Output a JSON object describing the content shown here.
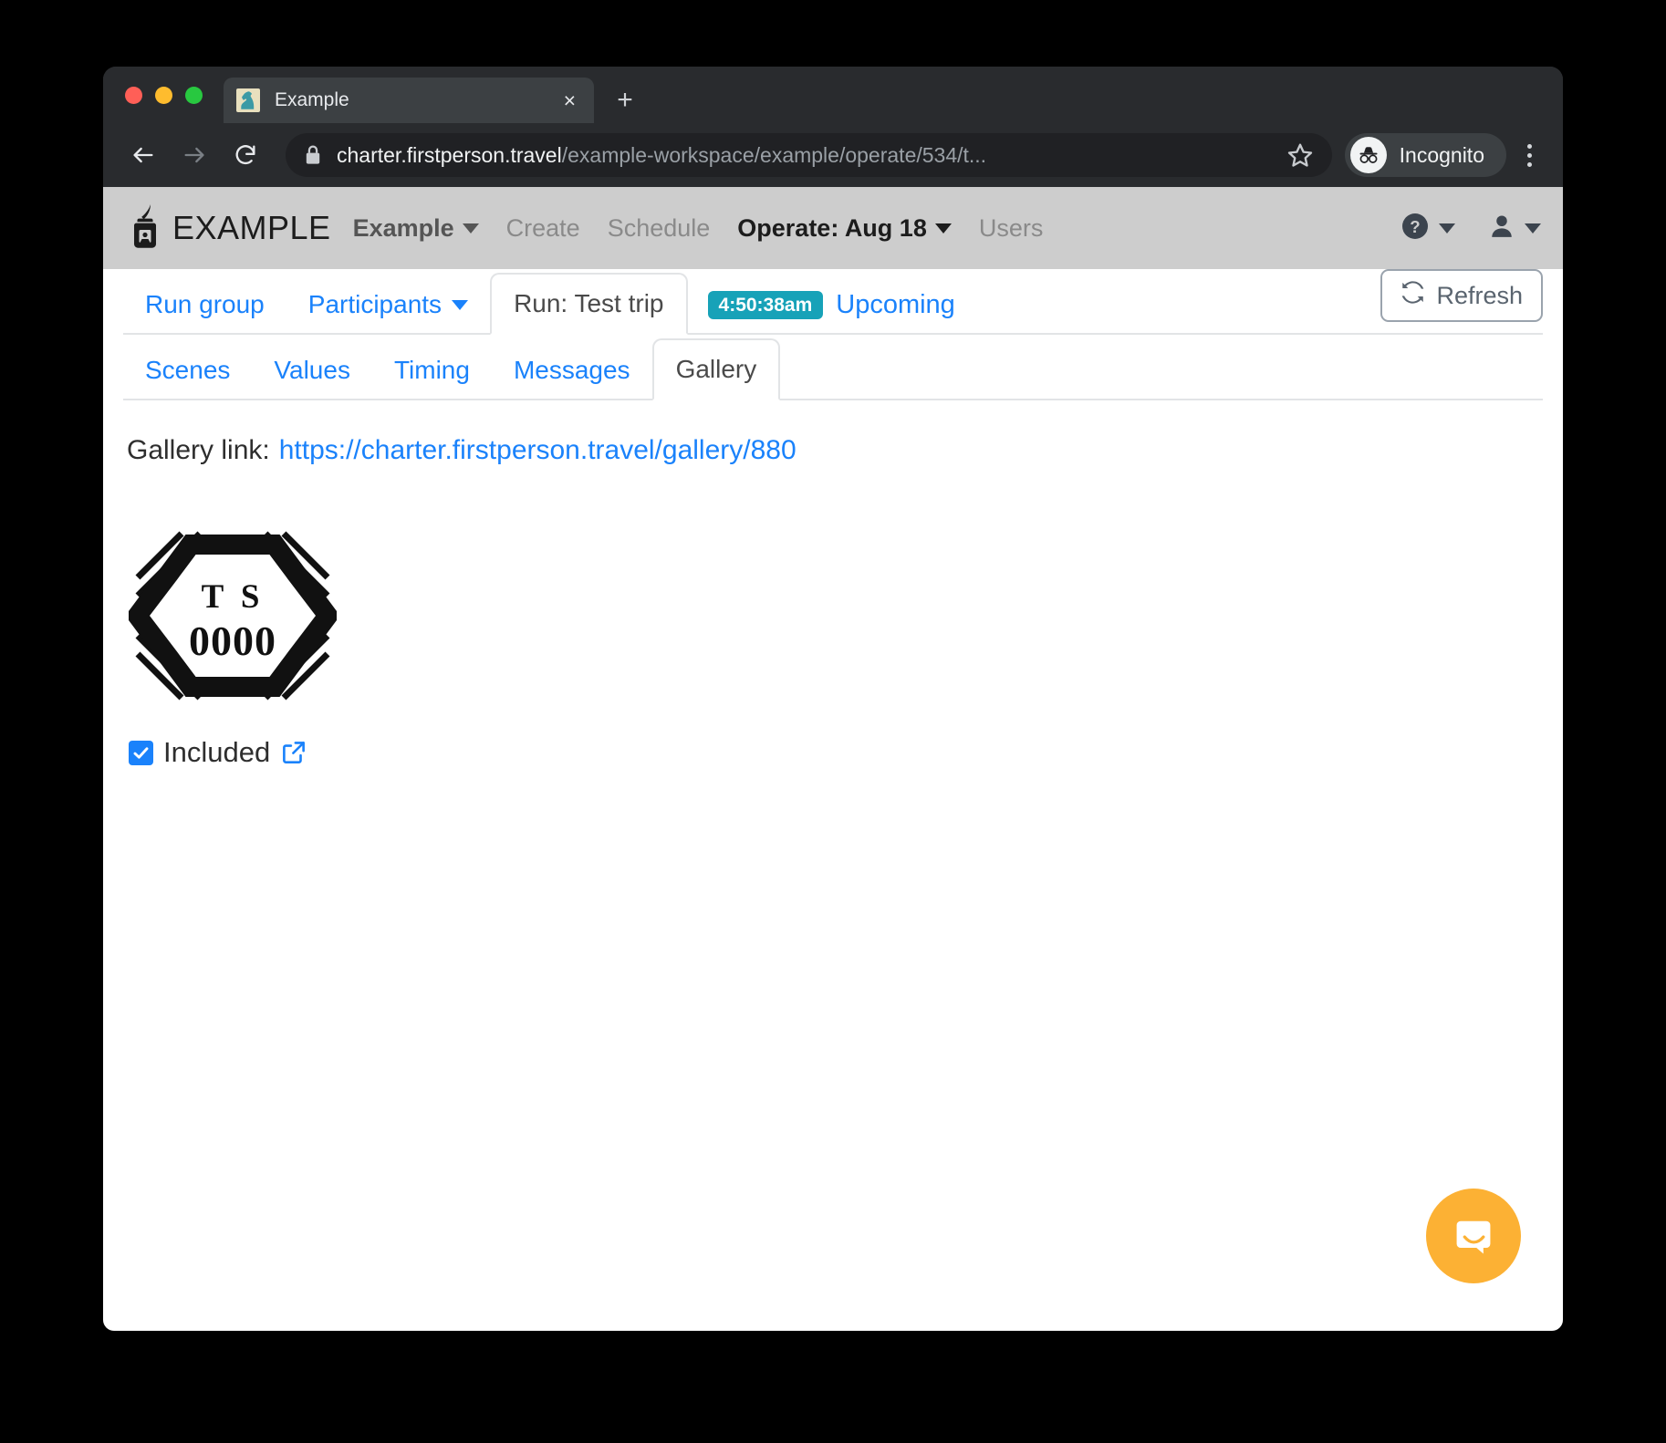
{
  "browser": {
    "tab": {
      "title": "Example",
      "favicon": "chess-knight-icon",
      "close_label": "×"
    },
    "new_tab_label": "+",
    "omnibox": {
      "host": "charter.firstperson.travel",
      "path": "/example-workspace/example/operate/534/t...",
      "lock": "lock-icon",
      "star": "star-icon"
    },
    "profile_pill": {
      "label": "Incognito",
      "icon": "incognito-icon"
    },
    "menu": "kebab-menu-icon"
  },
  "app_header": {
    "logo": "inkwell-quill-icon",
    "brand": "EXAMPLE",
    "nav": [
      {
        "label": "Example",
        "caret": true,
        "style": "strong"
      },
      {
        "label": "Create",
        "caret": false,
        "style": "muted"
      },
      {
        "label": "Schedule",
        "caret": false,
        "style": "muted"
      },
      {
        "label": "Operate: Aug 18",
        "caret": true,
        "style": "dark"
      },
      {
        "label": "Users",
        "caret": false,
        "style": "muted"
      }
    ],
    "help_icon": "help-circle-icon",
    "user_icon": "user-icon"
  },
  "primary_tabs": [
    {
      "label": "Run group",
      "caret": false,
      "active": false
    },
    {
      "label": "Participants",
      "caret": true,
      "active": false
    },
    {
      "label": "Run: Test trip",
      "caret": false,
      "active": true
    }
  ],
  "run_status": {
    "time": "4:50:38am",
    "state": "Upcoming",
    "badge_color": "#17a2b8"
  },
  "refresh_button": {
    "label": "Refresh",
    "icon": "refresh-icon"
  },
  "secondary_tabs": [
    {
      "label": "Scenes",
      "active": false
    },
    {
      "label": "Values",
      "active": false
    },
    {
      "label": "Timing",
      "active": false
    },
    {
      "label": "Messages",
      "active": false
    },
    {
      "label": "Gallery",
      "active": true
    }
  ],
  "gallery": {
    "link_label": "Gallery link:",
    "link_url": "https://charter.firstperson.travel/gallery/880",
    "photo": {
      "alt": "hexagonal-badge-logo",
      "text_top": "T S",
      "text_bottom": "0000"
    },
    "included": {
      "label": "Included",
      "checked": true,
      "external_link_icon": "external-link-icon"
    }
  },
  "intercom": {
    "icon": "chat-bubble-icon"
  },
  "colors": {
    "link_blue": "#1a82fb",
    "badge_teal": "#17a2b8",
    "intercom_orange": "#fcb134",
    "header_grey": "#cdcdcd"
  }
}
